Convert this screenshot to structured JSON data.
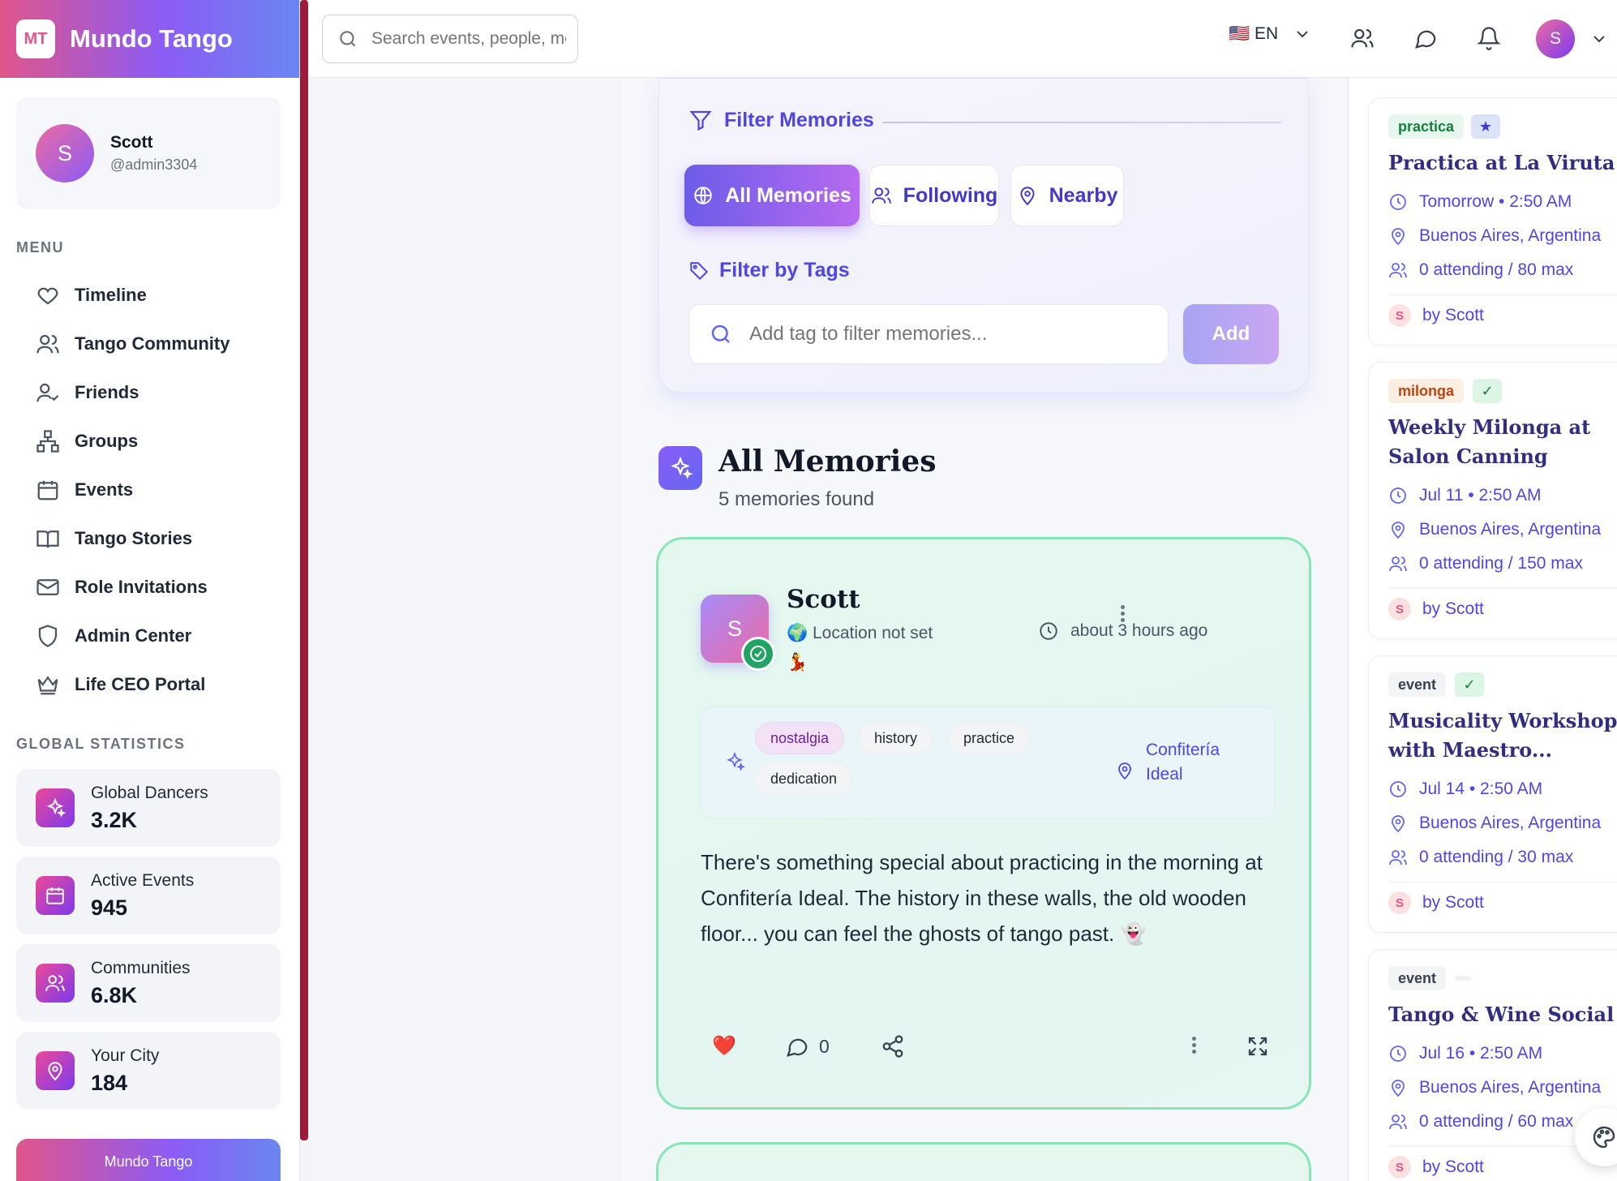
{
  "brand": {
    "logo": "MT",
    "name": "Mundo Tango"
  },
  "profile": {
    "initial": "S",
    "name": "Scott",
    "handle": "@admin3304"
  },
  "menu": {
    "label": "MENU",
    "items": [
      {
        "label": "Timeline",
        "icon": "heart-icon"
      },
      {
        "label": "Tango Community",
        "icon": "users-icon"
      },
      {
        "label": "Friends",
        "icon": "user-check-icon"
      },
      {
        "label": "Groups",
        "icon": "network-icon"
      },
      {
        "label": "Events",
        "icon": "calendar-icon"
      },
      {
        "label": "Tango Stories",
        "icon": "book-icon"
      },
      {
        "label": "Role Invitations",
        "icon": "mail-icon"
      },
      {
        "label": "Admin Center",
        "icon": "shield-icon"
      },
      {
        "label": "Life CEO Portal",
        "icon": "crown-icon"
      }
    ]
  },
  "stats": {
    "label": "GLOBAL STATISTICS",
    "items": [
      {
        "label": "Global Dancers",
        "value": "3.2K",
        "icon": "sparkles-icon"
      },
      {
        "label": "Active Events",
        "value": "945",
        "icon": "calendar-icon"
      },
      {
        "label": "Communities",
        "value": "6.8K",
        "icon": "users-icon"
      },
      {
        "label": "Your City",
        "value": "184",
        "icon": "map-pin-icon"
      }
    ]
  },
  "footer_button": "Mundo Tango",
  "topbar": {
    "search_placeholder": "Search events, people, memories...",
    "language": "🇺🇸 EN",
    "avatar_initial": "S"
  },
  "filter": {
    "title": "Filter Memories",
    "tabs": [
      {
        "label": "All Memories",
        "active": true
      },
      {
        "label": "Following",
        "active": false
      },
      {
        "label": "Nearby",
        "active": false
      }
    ],
    "tags_title": "Filter by Tags",
    "tag_placeholder": "Add tag to filter memories...",
    "add_label": "Add"
  },
  "section": {
    "title": "All Memories",
    "subtitle": "5 memories found"
  },
  "post": {
    "avatar_initial": "S",
    "author": "Scott",
    "location": "🌍 Location not set",
    "emoji": "💃",
    "time": "about 3 hours ago",
    "tags": [
      "nostalgia",
      "history",
      "practice",
      "dedication"
    ],
    "place": "Confitería Ideal",
    "body": "There's something special about practicing in the morning at Confitería Ideal. The history in these walls, the old wooden floor... you can feel the ghosts of tango past. 👻",
    "like_emoji": "❤️",
    "comment_count": "0"
  },
  "events": [
    {
      "type": "practica",
      "mark": "★",
      "title": "Practica at La Viruta",
      "when": "Tomorrow • 2:50 AM",
      "where": "Buenos Aires, Argentina",
      "attendance": "0 attending / 80 max",
      "by": "by Scott",
      "by_initial": "S"
    },
    {
      "type": "milonga",
      "mark": "✓",
      "title": "Weekly Milonga at Salon Canning",
      "when": "Jul 11 • 2:50 AM",
      "where": "Buenos Aires, Argentina",
      "attendance": "0 attending / 150 max",
      "by": "by Scott",
      "by_initial": "S"
    },
    {
      "type": "event",
      "mark": "✓",
      "title": "Musicality Workshop with Maestro...",
      "when": "Jul 14 • 2:50 AM",
      "where": "Buenos Aires, Argentina",
      "attendance": "0 attending / 30 max",
      "by": "by Scott",
      "by_initial": "S"
    },
    {
      "type": "event",
      "mark": "",
      "title": "Tango & Wine Social",
      "when": "Jul 16 • 2:50 AM",
      "where": "Buenos Aires, Argentina",
      "attendance": "0 attending / 60 max",
      "by": "by Scott",
      "by_initial": "S"
    }
  ],
  "colors": {
    "accent": "#4f46e5",
    "brand_pink": "#e0558a",
    "brand_purple": "#8b5cf6",
    "post_border": "#86e6b6"
  }
}
